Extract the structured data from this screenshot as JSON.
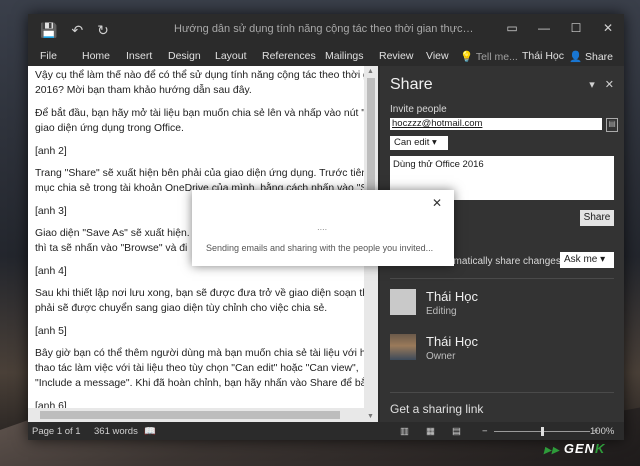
{
  "window": {
    "title": "Hướng dẫn sử dụng tính năng cộng tác theo thời gian thực trong Office...",
    "qat": {
      "save_icon": "save-icon",
      "undo_icon": "undo-icon",
      "redo_icon": "redo-icon"
    },
    "controls": {
      "restore": "▭",
      "minimize": "—",
      "maximize": "☐",
      "close": "✕"
    }
  },
  "ribbon": {
    "tabs": [
      "File",
      "Home",
      "Insert",
      "Design",
      "Layout",
      "References",
      "Mailings",
      "Review",
      "View"
    ],
    "tell_me": "Tell me...",
    "user": "Thái Học",
    "share": "Share"
  },
  "document": {
    "lines": [
      "Vậy cụ thể làm thế nào để có thể sử dụng tính năng cộng tác theo thời g",
      "2016? Mời bạn tham khảo hướng dẫn sau đây.",
      "Để bắt đầu, bạn hãy mở tài liệu bạn muốn chia sẻ lên và nhấp vào nút \"",
      "giao diện ứng dụng trong Office.",
      "[anh 2]",
      "Trang \"Share\" sẽ xuất hiện bên phải của giao diện ứng dụng. Trước tiên",
      "mục chia sẻ trong tài khoản OneDrive của mình, bằng cách nhấn vào \"Sa",
      "[anh 3]",
      "Giao diện \"Save As\" sẽ xuất hiện.",
      "thì ta sẽ nhấn vào \"Browse\" và đi",
      "[anh 4]",
      "Sau khi thiết lập nơi lưu xong, bạn sẽ được đưa trở về giao diện soạn th",
      "phải sẽ được chuyển sang giao diện tùy chỉnh cho việc chia sẻ.",
      "[anh 5]",
      "Bây giờ bạn có thể thêm người dùng mà bạn muốn chia sẻ tài liệu với họ",
      "thao tác làm việc với tài liệu theo tùy chọn \"Can edit\" hoặc \"Can view\",",
      "\"Include a message\". Khi đã hoàn chỉnh, bạn hãy nhấn vào Share để bắt",
      "[anh 6]"
    ]
  },
  "share_pane": {
    "title": "Share",
    "invite_label": "Invite people",
    "invite_value": "hoczzz@hotmail.com",
    "permission": "Can edit",
    "message": "Dùng thử Office 2016",
    "share_button": "Share",
    "auto_share_label": "ematically share changes:",
    "auto_share_value": "Ask me",
    "people": [
      {
        "name": "Thái Học",
        "role": "Editing"
      },
      {
        "name": "Thái Học",
        "role": "Owner"
      }
    ],
    "sharing_link": "Get a sharing link"
  },
  "status_bar": {
    "page": "Page 1 of 1",
    "words": "361 words",
    "zoom": "100%"
  },
  "dialog": {
    "message": "Sending emails and sharing with the people you invited...",
    "spinner": "∙∙∙∙"
  },
  "watermark": {
    "text": "GEN",
    "accent": "K"
  }
}
